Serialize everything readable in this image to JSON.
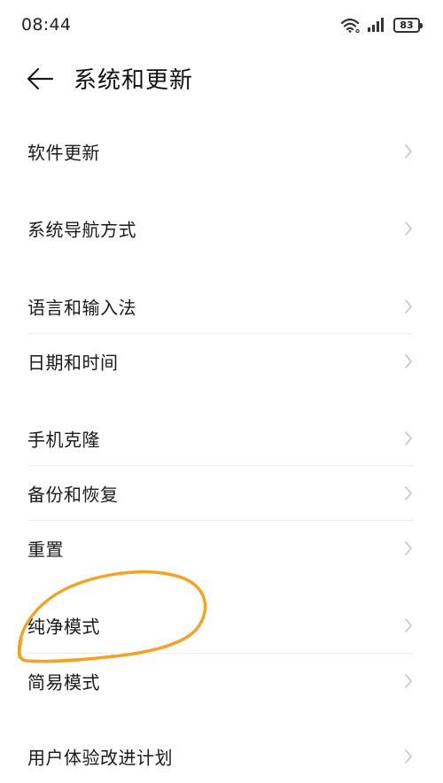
{
  "status_bar": {
    "time": "08:44",
    "battery": "83",
    "icons": [
      "wifi-icon",
      "signal-icon",
      "battery-icon"
    ]
  },
  "header": {
    "title": "系统和更新",
    "back_icon": "back-arrow-icon"
  },
  "settings": {
    "items": [
      {
        "label": "软件更新"
      },
      {
        "label": "系统导航方式"
      },
      {
        "label": "语言和输入法"
      },
      {
        "label": "日期和时间"
      },
      {
        "label": "手机克隆"
      },
      {
        "label": "备份和恢复"
      },
      {
        "label": "重置"
      },
      {
        "label": "纯净模式"
      },
      {
        "label": "简易模式"
      },
      {
        "label": "用户体验改进计划"
      }
    ],
    "chevron_icon": "chevron-right-icon"
  },
  "colors": {
    "background": "#ffffff",
    "text": "#1a1a1a",
    "chevron": "#c4c4c4",
    "divider": "#ececec",
    "annotation": "#f5a21e"
  }
}
